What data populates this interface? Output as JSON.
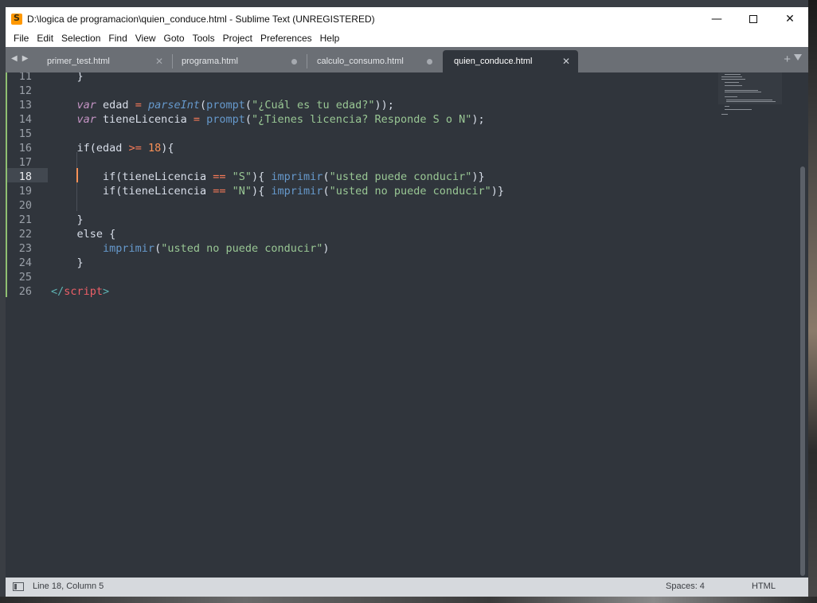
{
  "window": {
    "title": "D:\\logica de programacion\\quien_conduce.html - Sublime Text (UNREGISTERED)",
    "controls": {
      "minimize": "—",
      "close": "✕"
    }
  },
  "menu": [
    "File",
    "Edit",
    "Selection",
    "Find",
    "View",
    "Goto",
    "Tools",
    "Project",
    "Preferences",
    "Help"
  ],
  "tabs": [
    {
      "label": "primer_test.html",
      "state": "saved"
    },
    {
      "label": "programa.html",
      "state": "unsaved"
    },
    {
      "label": "calculo_consumo.html",
      "state": "unsaved"
    },
    {
      "label": "quien_conduce.html",
      "state": "active"
    }
  ],
  "tabbar_actions": {
    "new_tab": "+",
    "nav_back": "◀",
    "nav_forward": "▶"
  },
  "editor": {
    "current_line": 18,
    "lines": [
      {
        "n": "11",
        "tokens": [
          [
            "pun",
            "    }"
          ]
        ]
      },
      {
        "n": "12",
        "tokens": []
      },
      {
        "n": "13",
        "tokens": [
          [
            "pun",
            "    "
          ],
          [
            "kw",
            "var"
          ],
          [
            "var",
            " edad "
          ],
          [
            "op",
            "="
          ],
          [
            "pun",
            " "
          ],
          [
            "fni",
            "parseInt"
          ],
          [
            "pun",
            "("
          ],
          [
            "fn",
            "prompt"
          ],
          [
            "pun",
            "("
          ],
          [
            "str",
            "\"¿Cuál es tu edad?\""
          ],
          [
            "pun",
            "));"
          ]
        ]
      },
      {
        "n": "14",
        "tokens": [
          [
            "pun",
            "    "
          ],
          [
            "kw",
            "var"
          ],
          [
            "var",
            " tieneLicencia "
          ],
          [
            "op",
            "="
          ],
          [
            "pun",
            " "
          ],
          [
            "fn",
            "prompt"
          ],
          [
            "pun",
            "("
          ],
          [
            "str",
            "\"¿Tienes licencia? Responde S o N\""
          ],
          [
            "pun",
            ");"
          ]
        ]
      },
      {
        "n": "15",
        "tokens": []
      },
      {
        "n": "16",
        "tokens": [
          [
            "pun",
            "    "
          ],
          [
            "kw2",
            "if"
          ],
          [
            "pun",
            "(edad "
          ],
          [
            "op",
            ">="
          ],
          [
            "pun",
            " "
          ],
          [
            "num",
            "18"
          ],
          [
            "pun",
            "){"
          ]
        ]
      },
      {
        "n": "17",
        "tokens": []
      },
      {
        "n": "18",
        "tokens": [
          [
            "pun",
            "        "
          ],
          [
            "kw2",
            "if"
          ],
          [
            "pun",
            "(tieneLicencia "
          ],
          [
            "op",
            "=="
          ],
          [
            "pun",
            " "
          ],
          [
            "str",
            "\"S\""
          ],
          [
            "pun",
            "){ "
          ],
          [
            "fn",
            "imprimir"
          ],
          [
            "pun",
            "("
          ],
          [
            "str",
            "\"usted puede conducir\""
          ],
          [
            "pun",
            ")}"
          ]
        ]
      },
      {
        "n": "19",
        "tokens": [
          [
            "pun",
            "        "
          ],
          [
            "kw2",
            "if"
          ],
          [
            "pun",
            "(tieneLicencia "
          ],
          [
            "op",
            "=="
          ],
          [
            "pun",
            " "
          ],
          [
            "str",
            "\"N\""
          ],
          [
            "pun",
            "){ "
          ],
          [
            "fn",
            "imprimir"
          ],
          [
            "pun",
            "("
          ],
          [
            "str",
            "\"usted no puede conducir\""
          ],
          [
            "pun",
            ")}"
          ]
        ]
      },
      {
        "n": "20",
        "tokens": []
      },
      {
        "n": "21",
        "tokens": [
          [
            "pun",
            "    }"
          ]
        ]
      },
      {
        "n": "22",
        "tokens": [
          [
            "pun",
            "    "
          ],
          [
            "kw2",
            "else"
          ],
          [
            "pun",
            " {"
          ]
        ]
      },
      {
        "n": "23",
        "tokens": [
          [
            "pun",
            "        "
          ],
          [
            "fn",
            "imprimir"
          ],
          [
            "pun",
            "("
          ],
          [
            "str",
            "\"usted no puede conducir\""
          ],
          [
            "pun",
            ")"
          ]
        ]
      },
      {
        "n": "24",
        "tokens": [
          [
            "pun",
            "    }"
          ]
        ]
      },
      {
        "n": "25",
        "tokens": []
      },
      {
        "n": "26",
        "tokens": [
          [
            "tagp",
            "</"
          ],
          [
            "tag",
            "script"
          ],
          [
            "tagp",
            ">"
          ]
        ]
      }
    ]
  },
  "status": {
    "position": "Line 18, Column 5",
    "indentation": "Spaces: 4",
    "syntax": "HTML"
  },
  "colors": {
    "editor_bg": "#30353c",
    "tab_bar_bg": "#6b6f75",
    "status_bar_bg": "#d6d9dd",
    "string": "#99c794",
    "keyword": "#c594c5",
    "function": "#6699cc",
    "operator": "#f97b58",
    "number": "#f99157",
    "tag": "#ec5f67",
    "caret": "#f99157",
    "modified_gutter": "#8fbf72"
  }
}
